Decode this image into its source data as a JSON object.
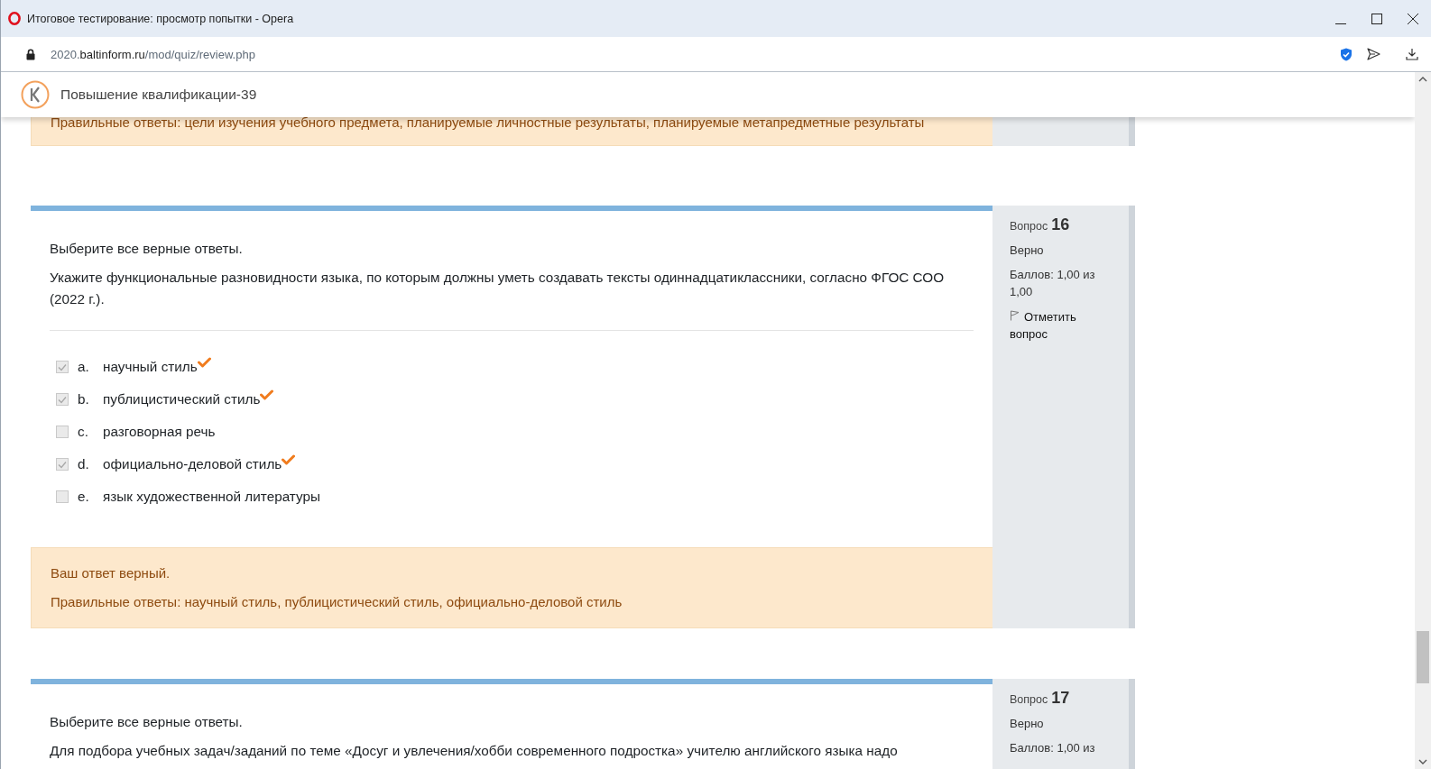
{
  "window": {
    "title": "Итоговое тестирование: просмотр попытки - Opera"
  },
  "address_bar": {
    "url_prefix": "2020.",
    "url_domain": "baltinform.ru",
    "url_path": "/mod/quiz/review.php"
  },
  "site_header": {
    "title": "Повышение квалификации-39"
  },
  "previous_question": {
    "correct_answers": "Правильные ответы: цели изучения учебного предмета, планируемые личностные результаты, планируемые метапредметные результаты"
  },
  "questions": [
    {
      "prefix": "Вопрос",
      "number": "16",
      "state": "Верно",
      "grade": "Баллов: 1,00 из 1,00",
      "flag_label": "Отметить вопрос",
      "instruction": "Выберите все верные ответы.",
      "text": "Укажите функциональные разновидности языка, по которым должны уметь создавать тексты одиннадцатиклассники, согласно ФГОС СОО (2022 г.).",
      "options": [
        {
          "letter": "a.",
          "text": "научный стиль",
          "checked": true,
          "correct": true
        },
        {
          "letter": "b.",
          "text": "публицистический стиль",
          "checked": true,
          "correct": true
        },
        {
          "letter": "c.",
          "text": "разговорная речь",
          "checked": false,
          "correct": false
        },
        {
          "letter": "d.",
          "text": "официально-деловой стиль",
          "checked": true,
          "correct": true
        },
        {
          "letter": "e.",
          "text": "язык художественной литературы",
          "checked": false,
          "correct": false
        }
      ],
      "feedback": {
        "message": "Ваш ответ верный.",
        "correct_answers": "Правильные ответы: научный стиль, публицистический стиль, официально-деловой стиль"
      }
    },
    {
      "prefix": "Вопрос",
      "number": "17",
      "state": "Верно",
      "grade": "Баллов: 1,00 из",
      "instruction": "Выберите все верные ответы.",
      "text": "Для подбора учебных задач/заданий по теме «Досуг и увлечения/хобби современного подростка» учителю английского языка надо"
    }
  ]
}
